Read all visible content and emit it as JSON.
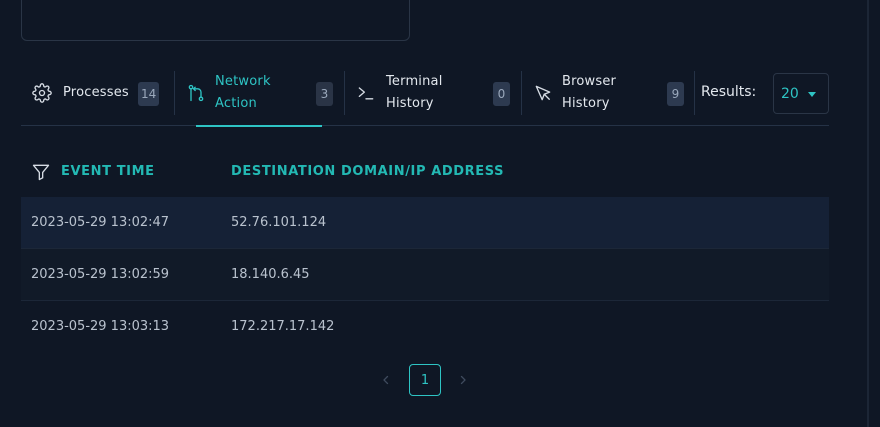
{
  "tabs": [
    {
      "label": "Processes",
      "count": "14",
      "icon": "gear-icon"
    },
    {
      "label": "Network Action",
      "count": "3",
      "icon": "git-branch-icon",
      "active": true
    },
    {
      "label": "Terminal History",
      "count": "0",
      "icon": "terminal-icon"
    },
    {
      "label": "Browser History",
      "count": "9",
      "icon": "cursor-pointer-icon"
    }
  ],
  "results": {
    "label": "Results:",
    "value": "20"
  },
  "table": {
    "columns": [
      "EVENT TIME",
      "DESTINATION DOMAIN/IP ADDRESS"
    ],
    "rows": [
      {
        "time": "2023-05-29 13:02:47",
        "address": "52.76.101.124"
      },
      {
        "time": "2023-05-29 13:02:59",
        "address": "18.140.6.45"
      },
      {
        "time": "2023-05-29 13:03:13",
        "address": "172.217.17.142"
      }
    ]
  },
  "pagination": {
    "current": "1"
  },
  "colors": {
    "accent": "#2ec4c4",
    "background": "#0f1725"
  }
}
